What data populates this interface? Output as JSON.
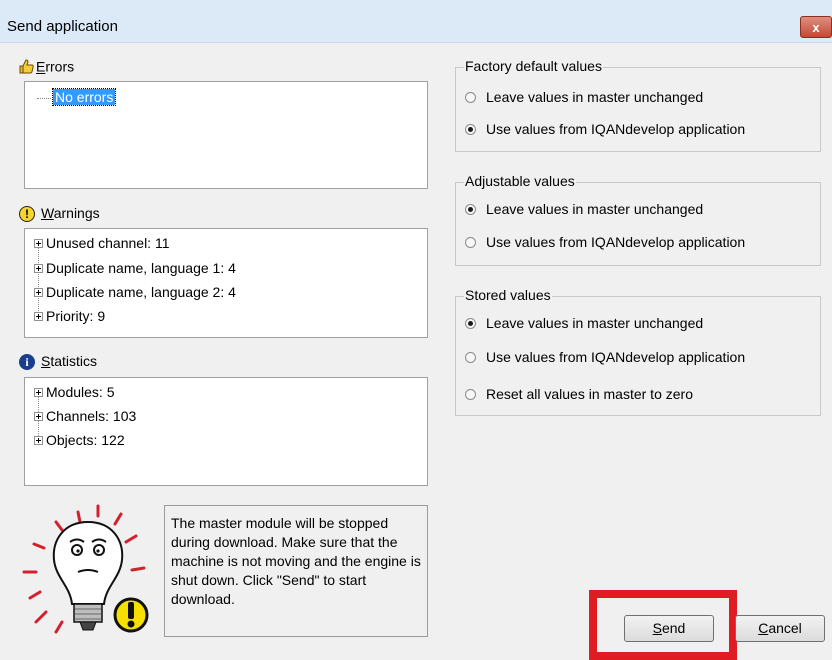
{
  "window": {
    "title": "Send application",
    "close_label": "x"
  },
  "errors": {
    "label_first": "E",
    "label_rest": "rrors",
    "items": [
      "No errors"
    ]
  },
  "warnings": {
    "label_first": "W",
    "label_rest": "arnings",
    "items": [
      "Unused channel: 11",
      "Duplicate name, language 1: 4",
      "Duplicate name, language 2: 4",
      "Priority: 9"
    ]
  },
  "statistics": {
    "label_first": "S",
    "label_rest": "tatistics",
    "items": [
      "Modules: 5",
      "Channels: 103",
      "Objects: 122"
    ]
  },
  "factory_default": {
    "title": "Factory default values",
    "options": [
      "Leave values in master unchanged",
      "Use values from IQANdevelop application"
    ],
    "selected": 1
  },
  "adjustable": {
    "title": "Adjustable values",
    "options": [
      "Leave values in master unchanged",
      "Use values from IQANdevelop application"
    ],
    "selected": 0
  },
  "stored": {
    "title": "Stored values",
    "options": [
      "Leave values in master unchanged",
      "Use values from IQANdevelop application",
      "Reset all values in master to zero"
    ],
    "selected": 0
  },
  "info": {
    "message": "The master module will be stopped during download. Make sure that the machine is not moving and the engine is shut down. Click \"Send\" to start download."
  },
  "buttons": {
    "send_first": "S",
    "send_rest": "end",
    "cancel_first": "C",
    "cancel_rest": "ancel"
  },
  "colors": {
    "highlight": "#e01b22",
    "selection": "#3399ff"
  },
  "icons": {
    "errors": "thumbs-up-icon",
    "warnings": "exclamation-icon",
    "statistics": "info-icon",
    "info": "lightbulb-warning-icon"
  }
}
